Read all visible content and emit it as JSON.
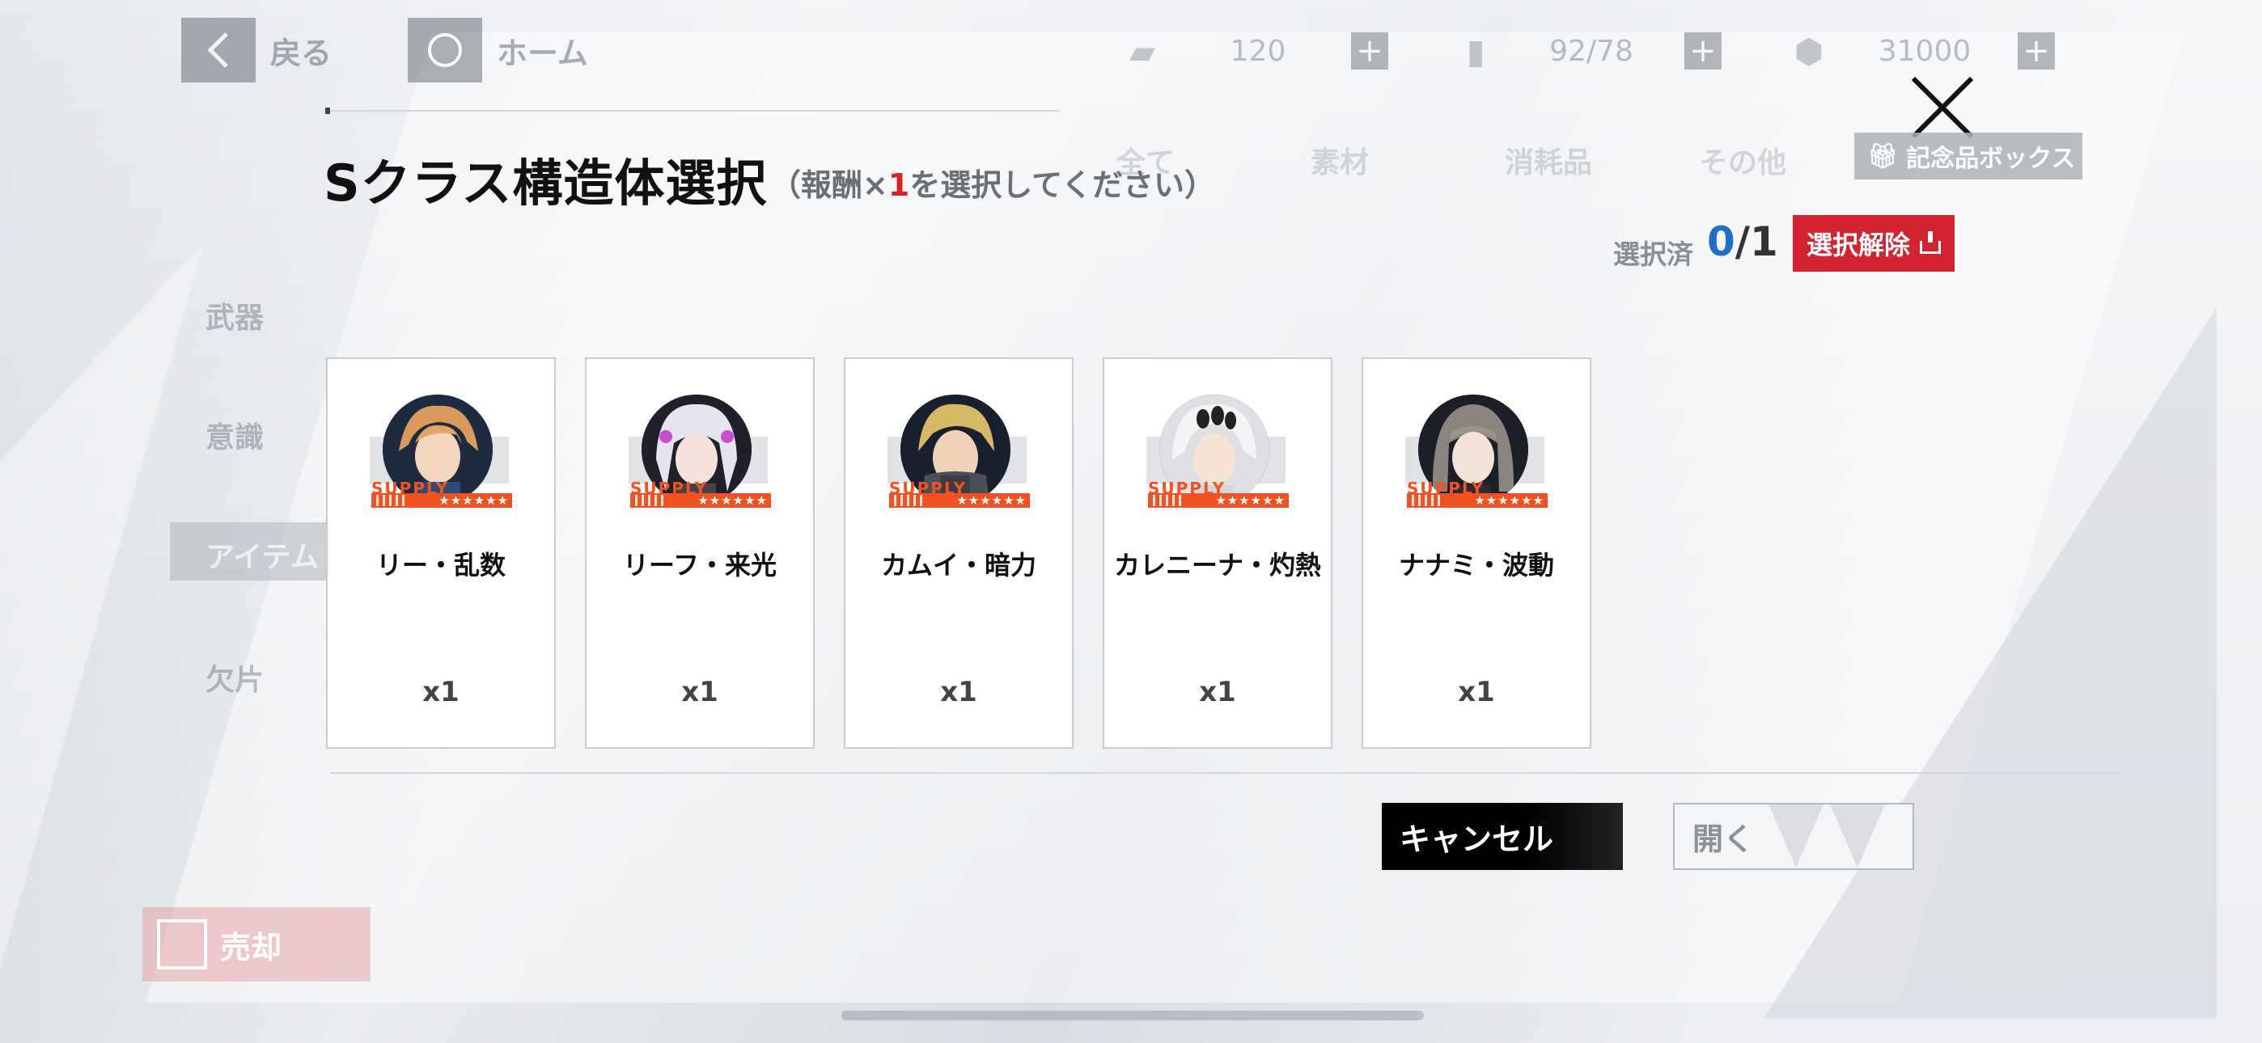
{
  "topbar": {
    "back_label": "戻る",
    "home_label": "ホーム",
    "resources": [
      {
        "icon": "ticket-icon",
        "value": "120"
      },
      {
        "icon": "battery-icon",
        "value": "92/78"
      },
      {
        "icon": "coin-icon",
        "value": "31000"
      }
    ]
  },
  "background": {
    "tabs": [
      "全て",
      "素材",
      "消耗品",
      "その他"
    ],
    "sidebar": [
      "武器",
      "意識",
      "アイテム",
      "欠片"
    ],
    "sell_label": "売却"
  },
  "modal": {
    "title": "Sクラス構造体選択",
    "subtitle_prefix": "（報酬×",
    "subtitle_accent": "1",
    "subtitle_suffix": "を選択してください）",
    "gift_box_label": "記念品ボックス",
    "selected_label": "選択済",
    "selected_current": "0",
    "selected_total": "/1",
    "deselect_label": "選択解除",
    "supply_text": "SUPPLY",
    "stars": "★★★★★★",
    "cards": [
      {
        "name": "リー・乱数",
        "qty": "x1"
      },
      {
        "name": "リーフ・来光",
        "qty": "x1"
      },
      {
        "name": "カムイ・暗力",
        "qty": "x1"
      },
      {
        "name": "カレニーナ・灼熱",
        "qty": "x1"
      },
      {
        "name": "ナナミ・波動",
        "qty": "x1"
      }
    ],
    "cancel_label": "キャンセル",
    "open_label": "開く"
  },
  "colors": {
    "accent_red": "#d4232e",
    "supply_orange": "#f2521f",
    "count_blue": "#1f6fc5"
  }
}
